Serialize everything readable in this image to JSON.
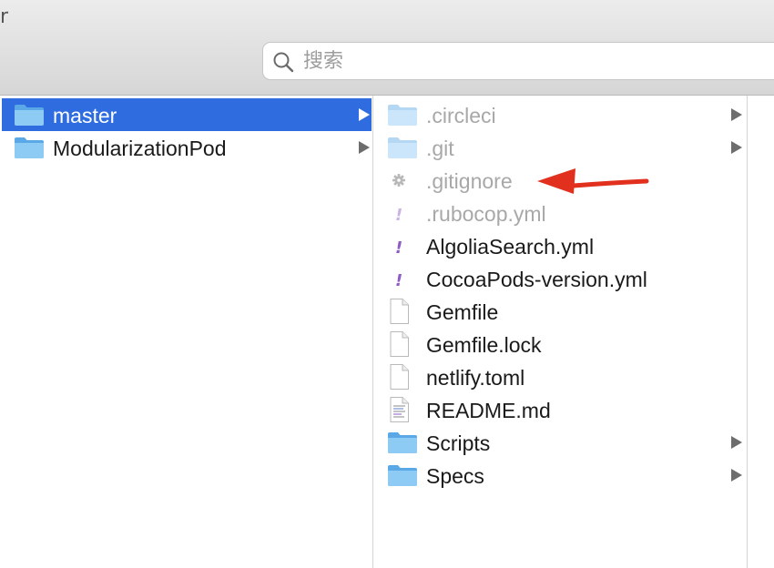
{
  "toolbar": {
    "glyph": "r"
  },
  "search": {
    "placeholder": "搜索",
    "value": ""
  },
  "column1": {
    "items": [
      {
        "label": "master",
        "icon": "folder-icon",
        "selected": true,
        "has_children": true
      },
      {
        "label": "ModularizationPod",
        "icon": "folder-icon",
        "selected": false,
        "has_children": true
      }
    ]
  },
  "column2": {
    "items": [
      {
        "label": ".circleci",
        "icon": "folder-icon",
        "hidden": true,
        "has_children": true
      },
      {
        "label": ".git",
        "icon": "folder-icon",
        "hidden": true,
        "has_children": true
      },
      {
        "label": ".gitignore",
        "icon": "gear-file-icon",
        "hidden": true,
        "has_children": false
      },
      {
        "label": ".rubocop.yml",
        "icon": "yaml-file-icon",
        "hidden": true,
        "has_children": false
      },
      {
        "label": "AlgoliaSearch.yml",
        "icon": "yaml-file-icon",
        "hidden": false,
        "has_children": false
      },
      {
        "label": "CocoaPods-version.yml",
        "icon": "yaml-file-icon",
        "hidden": false,
        "has_children": false
      },
      {
        "label": "Gemfile",
        "icon": "file-icon",
        "hidden": false,
        "has_children": false
      },
      {
        "label": "Gemfile.lock",
        "icon": "file-icon",
        "hidden": false,
        "has_children": false
      },
      {
        "label": "netlify.toml",
        "icon": "file-icon",
        "hidden": false,
        "has_children": false
      },
      {
        "label": "README.md",
        "icon": "text-file-icon",
        "hidden": false,
        "has_children": false
      },
      {
        "label": "Scripts",
        "icon": "folder-icon",
        "hidden": false,
        "has_children": true
      },
      {
        "label": "Specs",
        "icon": "folder-icon",
        "hidden": false,
        "has_children": true
      }
    ]
  },
  "colors": {
    "selection": "#2f6ce0",
    "folder": "#6cb8ee",
    "annotation_arrow": "#e2301f",
    "hidden_text": "#a8a8a8"
  }
}
